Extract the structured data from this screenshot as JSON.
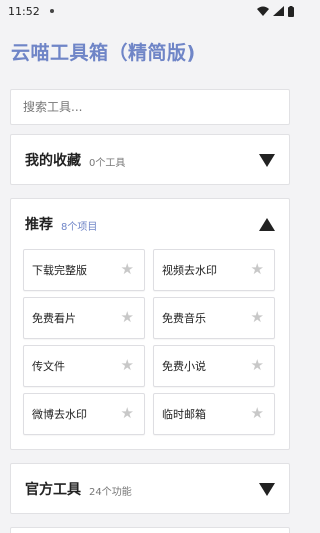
{
  "status_bar": {
    "time": "11:52"
  },
  "app": {
    "title": "云喵工具箱（精简版)"
  },
  "search": {
    "placeholder": "搜索工具..."
  },
  "favorites": {
    "title": "我的收藏",
    "count": "0个工具"
  },
  "recommended": {
    "title": "推荐",
    "count": "8个项目",
    "tools": [
      {
        "label": "下载完整版"
      },
      {
        "label": "视频去水印"
      },
      {
        "label": "免费看片"
      },
      {
        "label": "免费音乐"
      },
      {
        "label": "传文件"
      },
      {
        "label": "免费小说"
      },
      {
        "label": "微博去水印"
      },
      {
        "label": "临时邮箱"
      }
    ]
  },
  "official": {
    "title": "官方工具",
    "count": "24个功能"
  },
  "colors": {
    "accent": "#6f85c7",
    "background": "#f3f3f5",
    "star": "#c8c8c8"
  },
  "icons": [
    "notification-dot-icon",
    "wifi-icon",
    "signal-icon",
    "battery-icon",
    "star-icon",
    "triangle-down-icon",
    "triangle-up-icon"
  ]
}
